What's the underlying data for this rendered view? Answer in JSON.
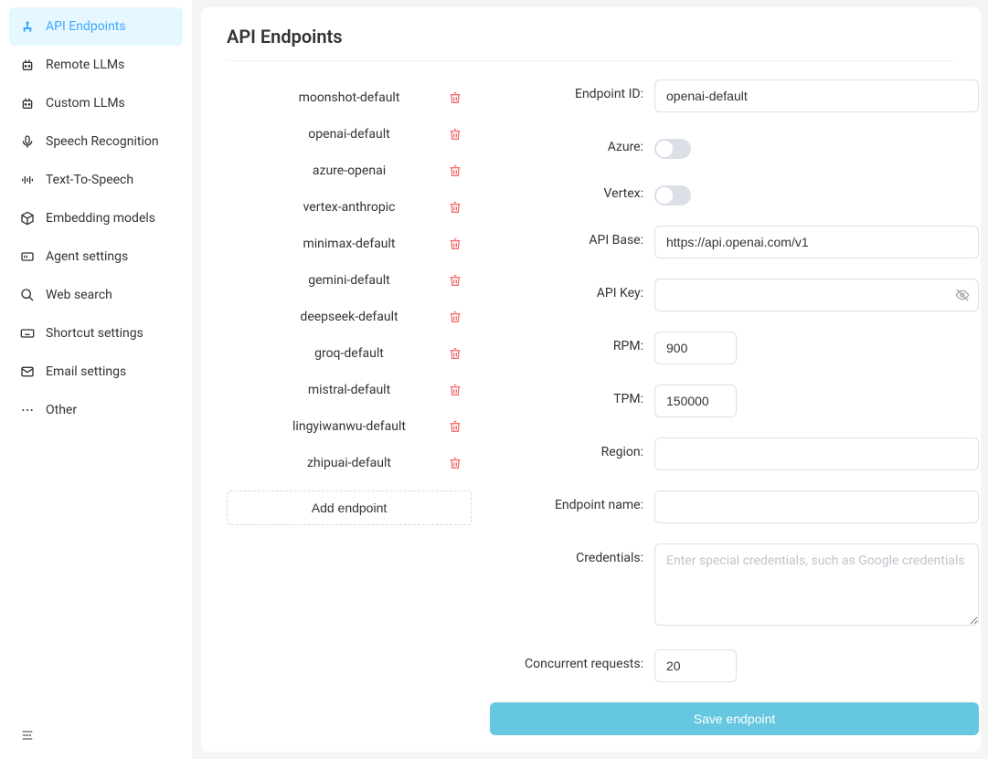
{
  "sidebar": {
    "items": [
      {
        "label": "API Endpoints",
        "icon": "api-icon",
        "active": true
      },
      {
        "label": "Remote LLMs",
        "icon": "robot-icon",
        "active": false
      },
      {
        "label": "Custom LLMs",
        "icon": "robot-icon",
        "active": false
      },
      {
        "label": "Speech Recognition",
        "icon": "mic-icon",
        "active": false
      },
      {
        "label": "Text-To-Speech",
        "icon": "waveform-icon",
        "active": false
      },
      {
        "label": "Embedding models",
        "icon": "cube-icon",
        "active": false
      },
      {
        "label": "Agent settings",
        "icon": "agent-icon",
        "active": false
      },
      {
        "label": "Web search",
        "icon": "search-icon",
        "active": false
      },
      {
        "label": "Shortcut settings",
        "icon": "keyboard-icon",
        "active": false
      },
      {
        "label": "Email settings",
        "icon": "mail-icon",
        "active": false
      },
      {
        "label": "Other",
        "icon": "more-icon",
        "active": false
      }
    ]
  },
  "page": {
    "title": "API Endpoints"
  },
  "endpoints": [
    "moonshot-default",
    "openai-default",
    "azure-openai",
    "vertex-anthropic",
    "minimax-default",
    "gemini-default",
    "deepseek-default",
    "groq-default",
    "mistral-default",
    "lingyiwanwu-default",
    "zhipuai-default"
  ],
  "add_endpoint_label": "Add endpoint",
  "form": {
    "endpoint_id": {
      "label": "Endpoint ID:",
      "value": "openai-default"
    },
    "azure": {
      "label": "Azure:",
      "value": false
    },
    "vertex": {
      "label": "Vertex:",
      "value": false
    },
    "api_base": {
      "label": "API Base:",
      "value": "https://api.openai.com/v1"
    },
    "api_key": {
      "label": "API Key:",
      "value": ""
    },
    "rpm": {
      "label": "RPM:",
      "value": "900"
    },
    "tpm": {
      "label": "TPM:",
      "value": "150000"
    },
    "region": {
      "label": "Region:",
      "value": ""
    },
    "endpoint_name": {
      "label": "Endpoint name:",
      "value": ""
    },
    "credentials": {
      "label": "Credentials:",
      "placeholder": "Enter special credentials, such as Google credentials",
      "value": ""
    },
    "concurrent": {
      "label": "Concurrent requests:",
      "value": "20"
    },
    "save_label": "Save endpoint"
  }
}
